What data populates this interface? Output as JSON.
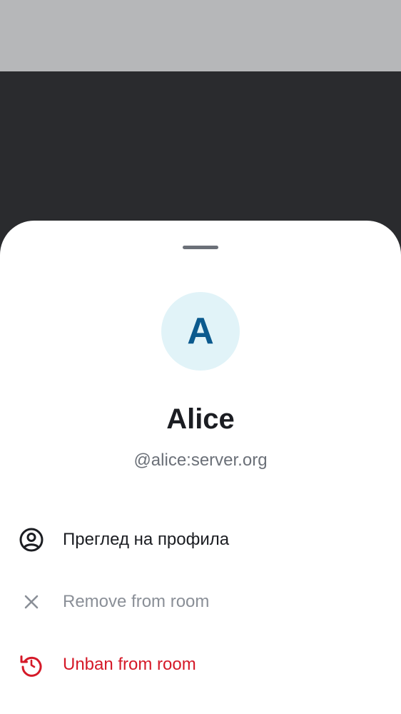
{
  "user": {
    "avatar_letter": "A",
    "display_name": "Alice",
    "user_id": "@alice:server.org"
  },
  "actions": [
    {
      "label": "Преглед на профила",
      "icon": "user-profile-icon",
      "state": "default"
    },
    {
      "label": "Remove from room",
      "icon": "close-icon",
      "state": "disabled"
    },
    {
      "label": "Unban from room",
      "icon": "restart-icon",
      "state": "critical"
    }
  ],
  "colors": {
    "avatar_bg": "#e1f3f8",
    "avatar_text": "#0b5a8e",
    "text_primary": "#1b1d22",
    "text_secondary": "#6b7078",
    "disabled": "#8a8f97",
    "critical": "#d51928"
  }
}
